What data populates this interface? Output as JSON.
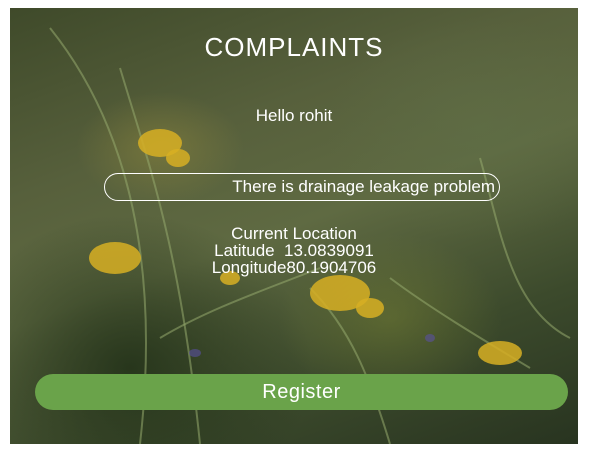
{
  "screen": {
    "title": "COMPLAINTS",
    "greeting": "Hello rohit"
  },
  "complaint": {
    "value": "There is drainage leakage problem"
  },
  "location": {
    "heading": "Current Location",
    "latitude_text": "Latitude  13.0839091",
    "longitude_text": "Longitude80.1904706"
  },
  "actions": {
    "register_label": "Register"
  },
  "colors": {
    "button": "#6aa34a",
    "text": "#ffffff"
  }
}
